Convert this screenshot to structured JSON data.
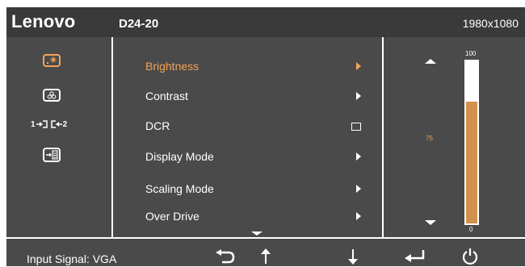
{
  "header": {
    "brand": "Lenovo",
    "model": "D24-20",
    "resolution": "1980x1080"
  },
  "sidebar": {
    "icons": [
      "brightness-icon",
      "color-icon",
      "input-switch-icon",
      "menu-settings-icon"
    ],
    "input_labels": [
      "1",
      "2"
    ]
  },
  "menu": {
    "items": [
      {
        "label": "Brightness",
        "type": "submenu",
        "active": true
      },
      {
        "label": "Contrast",
        "type": "submenu"
      },
      {
        "label": "DCR",
        "type": "checkbox",
        "checked": false
      },
      {
        "label": "Display Mode",
        "type": "submenu"
      },
      {
        "label": "Scaling Mode",
        "type": "submenu"
      },
      {
        "label": "Over Drive",
        "type": "submenu"
      }
    ]
  },
  "slider": {
    "max_label": "100",
    "min_label": "0",
    "current_label": "75",
    "value": 75,
    "max": 100,
    "fill_color": "#d3904c"
  },
  "footer": {
    "input_signal": "Input Signal: VGA",
    "buttons": [
      "back-icon",
      "up-arrow-icon",
      "down-arrow-icon",
      "enter-icon",
      "power-icon"
    ]
  },
  "colors": {
    "accent": "#f3a35b",
    "background": "#4a4a4a",
    "header": "#3a3a3a"
  }
}
